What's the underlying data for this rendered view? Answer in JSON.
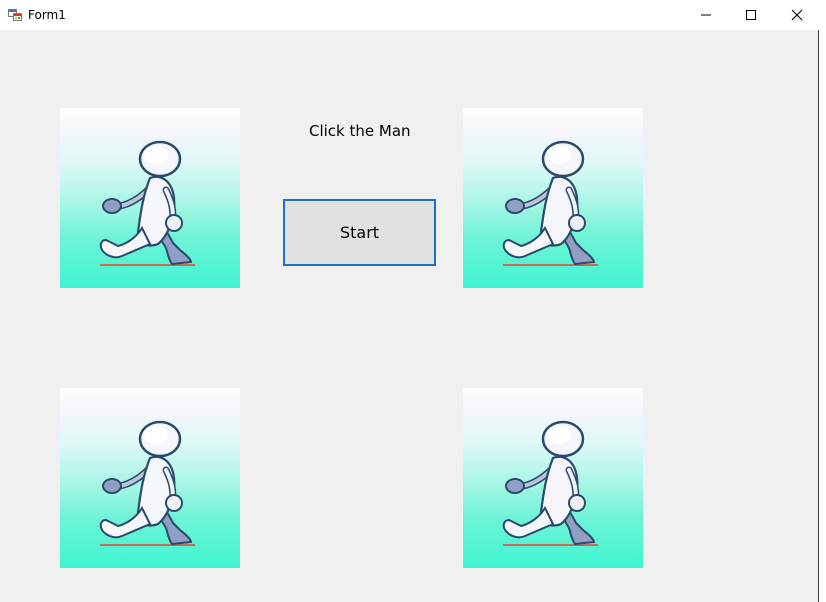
{
  "window": {
    "title": "Form1",
    "icon": "form-app-icon",
    "controls": [
      "minimize-icon",
      "maximize-icon",
      "close-icon"
    ]
  },
  "form": {
    "label": "Click the Man",
    "start_button": "Start",
    "images": [
      {
        "name": "man-picture-top-left",
        "icon": "walking-man-figure"
      },
      {
        "name": "man-picture-top-right",
        "icon": "walking-man-figure"
      },
      {
        "name": "man-picture-bottom-left",
        "icon": "walking-man-figure"
      },
      {
        "name": "man-picture-bottom-right",
        "icon": "walking-man-figure"
      }
    ]
  },
  "colors": {
    "button_focus_border": "#1a73c7",
    "form_background": "#f0f0f0",
    "picture_gradient_bottom": "#3ef5d0"
  }
}
